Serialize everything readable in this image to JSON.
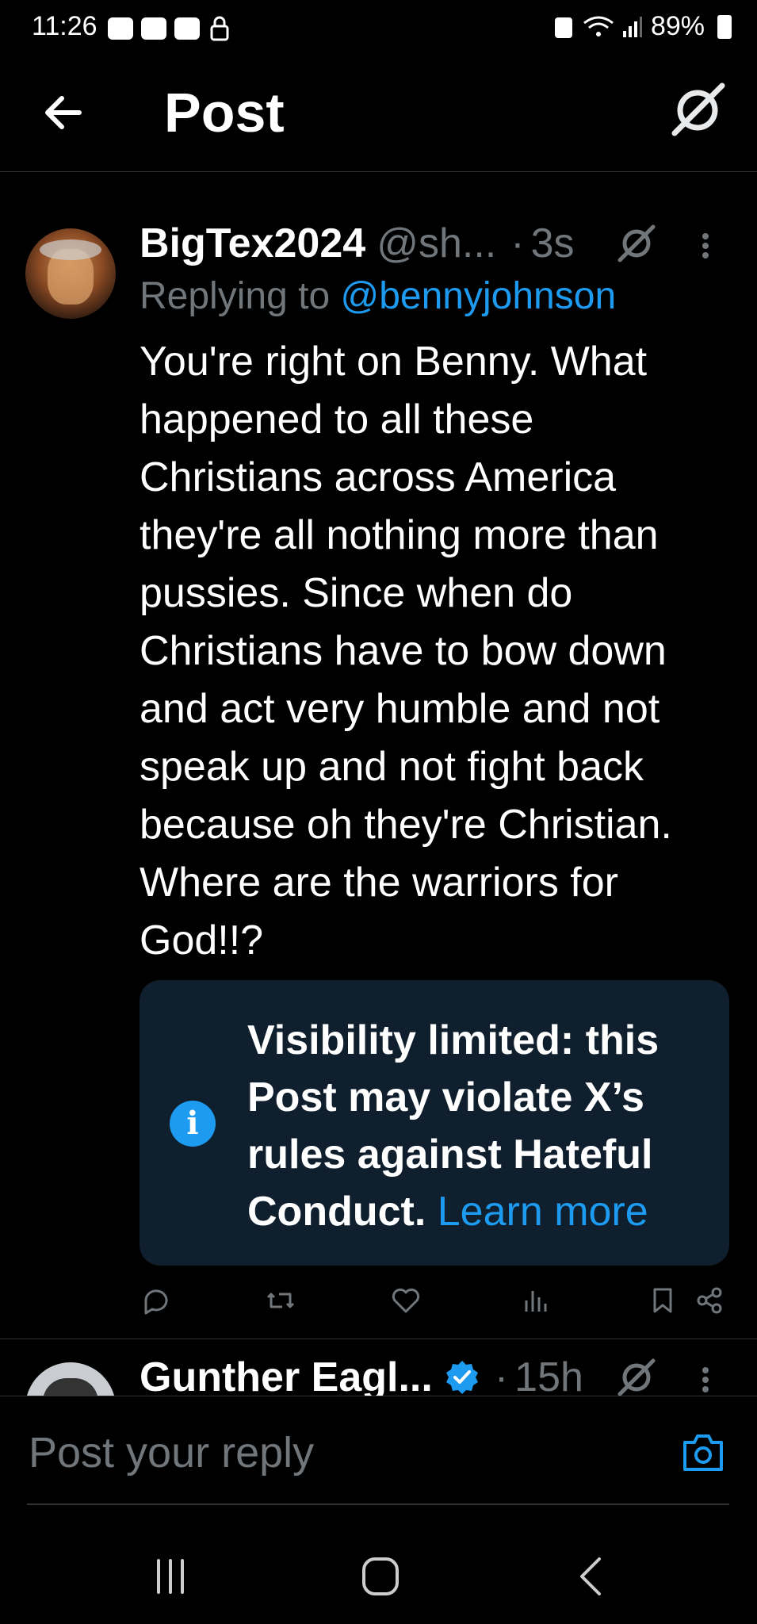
{
  "status_bar": {
    "time": "11:26",
    "battery": "89%"
  },
  "header": {
    "title": "Post"
  },
  "tweet": {
    "author": "BigTex2024",
    "handle": "@sh...",
    "time": "3s",
    "replying_prefix": "Replying to ",
    "replying_to": "@bennyjohnson",
    "body": "You're right on Benny. What happened to all these Christians across America they're all nothing more than pussies. Since when do Christians have to bow down and act very humble and not speak up and not fight back because oh they're Christian. Where are the warriors for God!!?",
    "notice": {
      "text": "Visibility limited: this Post may violate X’s rules against Hateful Conduct.",
      "link": "Learn more"
    }
  },
  "tweet2": {
    "author": "Gunther Eagl...",
    "time": "15h"
  },
  "reply_bar": {
    "placeholder": "Post your reply"
  },
  "colors": {
    "accent": "#1d9bf0",
    "muted": "#71767b",
    "notice_bg": "#101f2d"
  }
}
